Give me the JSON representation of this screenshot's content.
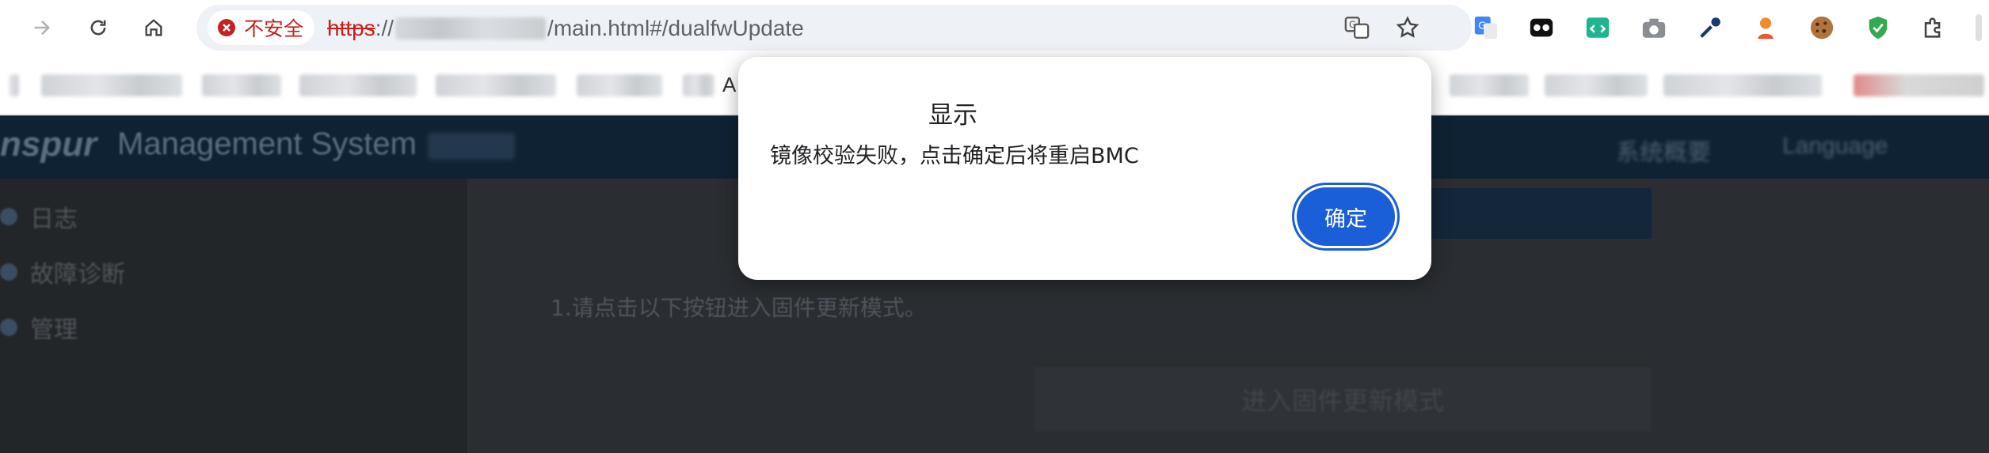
{
  "browser": {
    "security_label": "不安全",
    "url_scheme": "https",
    "url_sep": "://",
    "url_path": "/main.html#/dualfwUpdate",
    "bookmark_visible_letter": "A"
  },
  "app": {
    "brand": "nspur",
    "title": "Management System",
    "top_right_1": "系统概要",
    "top_right_2": "Language",
    "sidebar": [
      {
        "label": "日志"
      },
      {
        "label": "故障诊断"
      },
      {
        "label": "管理"
      }
    ],
    "instruction": "1.请点击以下按钮进入固件更新模式。",
    "enter_update_button": "进入固件更新模式"
  },
  "dialog": {
    "title": "显示",
    "message": "镜像校验失败，点击确定后将重启BMC",
    "ok_label": "确定"
  },
  "colors": {
    "accent": "#1a5ed8",
    "danger": "#c5221f",
    "overlay_bg": "#2a2d31"
  }
}
